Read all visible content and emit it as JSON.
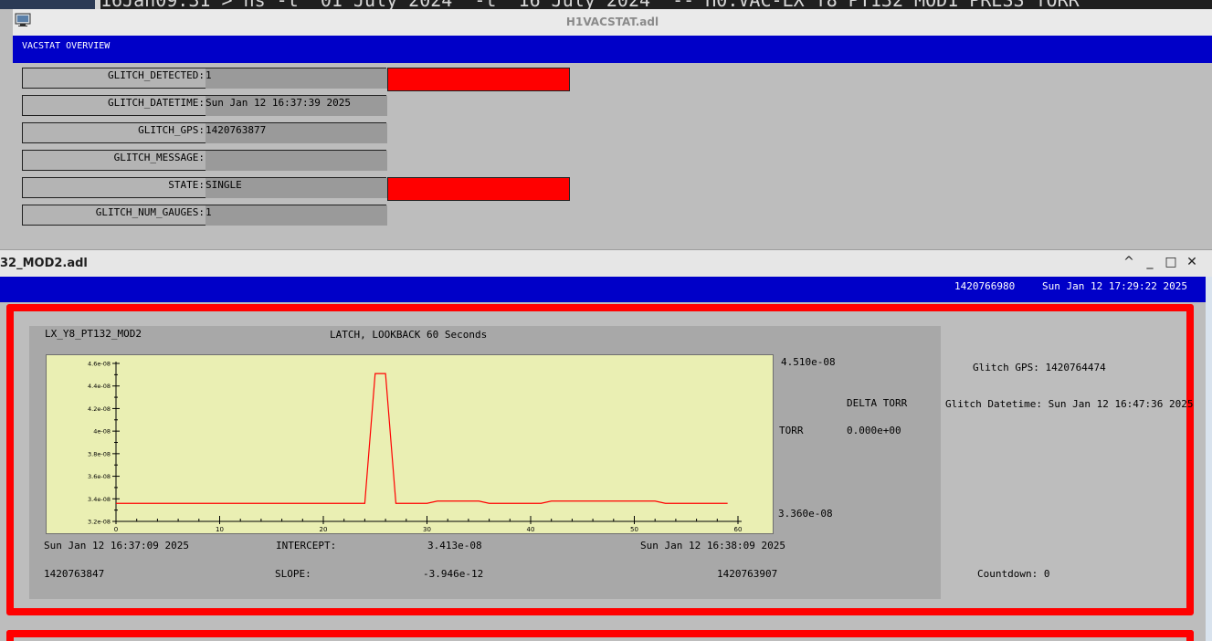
{
  "terminal": {
    "text": "16Jan09:31 > hs -t '01 July 2024' -t '16 July 2024' -- H0:VAC-LX_Y8_PT132_MOD1_PRESS_TORR"
  },
  "vacstat_window": {
    "title": "H1VACSTAT.adl",
    "header": "VACSTAT OVERVIEW",
    "rows": [
      {
        "label": "GLITCH_DETECTED:",
        "value": "1",
        "alarm": true
      },
      {
        "label": "GLITCH_DATETIME:",
        "value": "Sun Jan 12 16:37:39 2025",
        "alarm": false
      },
      {
        "label": "GLITCH_GPS:",
        "value": "1420763877",
        "alarm": false
      },
      {
        "label": "GLITCH_MESSAGE:",
        "value": "",
        "alarm": false
      },
      {
        "label": "STATE:",
        "value": "SINGLE",
        "alarm": true
      },
      {
        "label": "GLITCH_NUM_GAUGES:",
        "value": "1",
        "alarm": false
      }
    ],
    "alarm_color": "#ff0000"
  },
  "mod2_window": {
    "title": "32_MOD2.adl",
    "header_gps": "1420766980",
    "header_datetime": "Sun Jan 12 17:29:22 2025",
    "controls": {
      "collapse": "^",
      "minimize": "_",
      "maximize": "□",
      "close": "✕"
    }
  },
  "plot_panel": {
    "channel": "LX_Y8_PT132_MOD2",
    "mode": "LATCH, LOOKBACK 60 Seconds",
    "ymax_label": "4.510e-08",
    "ymin_label": "3.360e-08",
    "torr_label": "TORR",
    "start_datetime": "Sun Jan 12 16:37:09 2025",
    "end_datetime": "Sun Jan 12 16:38:09 2025",
    "start_gps": "1420763847",
    "end_gps": "1420763907",
    "intercept_label": "INTERCEPT:",
    "intercept_value": "3.413e-08",
    "slope_label": "SLOPE:",
    "slope_value": "-3.946e-12"
  },
  "delta": {
    "label": "DELTA TORR",
    "value": "0.000e+00"
  },
  "glitch_info": {
    "gps_label": "Glitch GPS:",
    "gps_value": "1420764474",
    "datetime_label": "Glitch Datetime:",
    "datetime_value": "Sun Jan 12 16:47:36 2025",
    "countdown_label": "Countdown:",
    "countdown_value": "0"
  },
  "chart_data": {
    "type": "line",
    "xlim": [
      0,
      60
    ],
    "ylim": [
      3.2e-08,
      4.6e-08
    ],
    "x_ticks": [
      "0",
      "10",
      "20",
      "30",
      "40",
      "50",
      "60"
    ],
    "y_ticks": [
      "3.2e-08",
      "3.4e-08",
      "3.6e-08",
      "3.8e-08",
      "4e-08",
      "4.2e-08",
      "4.4e-08",
      "4.6e-08"
    ],
    "y_tick_values": [
      3.2e-08,
      3.4e-08,
      3.6e-08,
      3.8e-08,
      4e-08,
      4.2e-08,
      4.4e-08,
      4.6e-08
    ],
    "series": [
      {
        "color": "#ff0000",
        "x": [
          0,
          24,
          25,
          26,
          27,
          28,
          30,
          31,
          33,
          35,
          36,
          38,
          40,
          41,
          42,
          44,
          46,
          48,
          50,
          52,
          53,
          55,
          57,
          59
        ],
        "y": [
          3.36e-08,
          3.36e-08,
          4.51e-08,
          4.51e-08,
          3.36e-08,
          3.36e-08,
          3.36e-08,
          3.38e-08,
          3.38e-08,
          3.38e-08,
          3.36e-08,
          3.36e-08,
          3.36e-08,
          3.36e-08,
          3.38e-08,
          3.38e-08,
          3.38e-08,
          3.38e-08,
          3.38e-08,
          3.38e-08,
          3.36e-08,
          3.36e-08,
          3.36e-08,
          3.36e-08
        ]
      }
    ]
  }
}
